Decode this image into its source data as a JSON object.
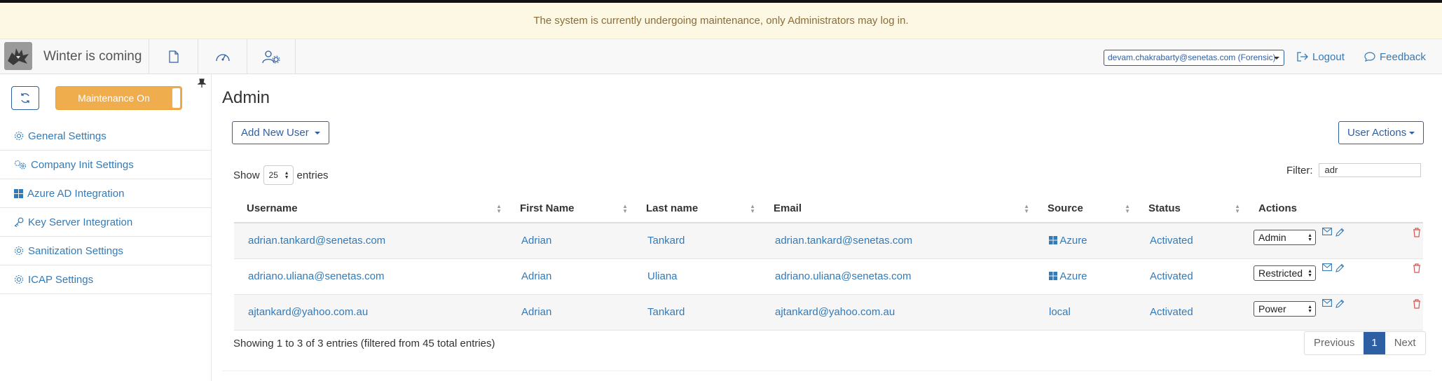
{
  "banner": {
    "message": "The system is currently undergoing maintenance, only Administrators may log in."
  },
  "navbar": {
    "brand": "Winter is coming",
    "user": "devam.chakrabarty@senetas.com (Forensic)",
    "logout": "Logout",
    "feedback": "Feedback"
  },
  "sidebar": {
    "maintenance_label": "Maintenance On",
    "items": [
      {
        "label": "General Settings",
        "icon": "gear-icon"
      },
      {
        "label": "Company Init Settings",
        "icon": "gears-icon"
      },
      {
        "label": "Azure AD Integration",
        "icon": "windows-icon"
      },
      {
        "label": "Key Server Integration",
        "icon": "key-icon"
      },
      {
        "label": "Sanitization Settings",
        "icon": "gear-icon"
      },
      {
        "label": "ICAP Settings",
        "icon": "gear-icon"
      }
    ]
  },
  "main": {
    "title": "Admin",
    "add_user": "Add New User",
    "user_actions": "User Actions",
    "show": "Show",
    "entries_value": "25",
    "entries": "entries",
    "filter_label": "Filter:",
    "filter_value": "adr",
    "columns": [
      "Username",
      "First Name",
      "Last name",
      "Email",
      "Source",
      "Status",
      "Actions"
    ],
    "rows": [
      {
        "username": "adrian.tankard@senetas.com",
        "first": "Adrian",
        "last": "Tankard",
        "email": "adrian.tankard@senetas.com",
        "source": "Azure",
        "status": "Activated",
        "role": "Admin"
      },
      {
        "username": "adriano.uliana@senetas.com",
        "first": "Adrian",
        "last": "Uliana",
        "email": "adriano.uliana@senetas.com",
        "source": "Azure",
        "status": "Activated",
        "role": "Restricted"
      },
      {
        "username": "ajtankard@yahoo.com.au",
        "first": "Adrian",
        "last": "Tankard",
        "email": "ajtankard@yahoo.com.au",
        "source": "local",
        "status": "Activated",
        "role": "Power"
      }
    ],
    "info": "Showing 1 to 3 of 3 entries (filtered from 45 total entries)",
    "pagination": {
      "previous": "Previous",
      "page": "1",
      "next": "Next"
    }
  }
}
